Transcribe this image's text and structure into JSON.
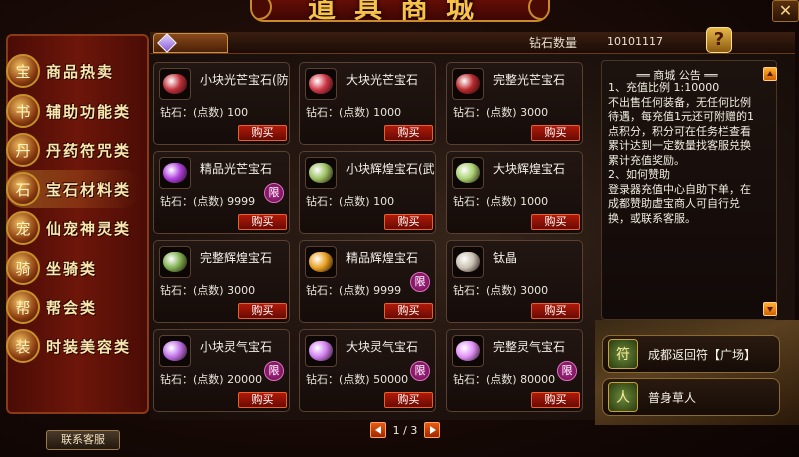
{
  "window": {
    "title": "道具商城",
    "close_symbol": "✕"
  },
  "header": {
    "diamond_label": "钻石数量",
    "diamond_value": "10101117",
    "help_icon": "scroll-help-icon"
  },
  "sidebar": {
    "items": [
      {
        "label": "商品热卖",
        "icon": "treasure-chest-icon",
        "glyph": "宝"
      },
      {
        "label": "辅助功能类",
        "icon": "book-icon",
        "glyph": "书"
      },
      {
        "label": "丹药符咒类",
        "icon": "pill-icon",
        "glyph": "丹"
      },
      {
        "label": "宝石材料类",
        "icon": "gem-icon",
        "glyph": "石",
        "active": true
      },
      {
        "label": "仙宠神灵类",
        "icon": "pet-icon",
        "glyph": "宠"
      },
      {
        "label": "坐骑类",
        "icon": "mount-icon",
        "glyph": "骑"
      },
      {
        "label": "帮会类",
        "icon": "guild-icon",
        "glyph": "帮"
      },
      {
        "label": "时装美容类",
        "icon": "fashion-icon",
        "glyph": "装"
      }
    ],
    "support_button": "联系客服"
  },
  "tabs": [
    {
      "icon": "purple-gem-icon"
    }
  ],
  "products": [
    {
      "name": "小块光芒宝石(防",
      "price": "钻石：(点数) 100",
      "buy": "购买",
      "color": "#c0303a",
      "limited": false
    },
    {
      "name": "大块光芒宝石",
      "price": "钻石：(点数) 1000",
      "buy": "购买",
      "color": "#d03848",
      "limited": false
    },
    {
      "name": "完整光芒宝石",
      "price": "钻石：(点数) 3000",
      "buy": "购买",
      "color": "#b8282c",
      "limited": false
    },
    {
      "name": "精品光芒宝石",
      "price": "钻石：(点数) 9999",
      "buy": "购买",
      "color": "#b040e0",
      "limited": true
    },
    {
      "name": "小块辉煌宝石(武",
      "price": "钻石：(点数) 100",
      "buy": "购买",
      "color": "#9ac060",
      "limited": false
    },
    {
      "name": "大块辉煌宝石",
      "price": "钻石：(点数) 1000",
      "buy": "购买",
      "color": "#a8d070",
      "limited": false
    },
    {
      "name": "完整辉煌宝石",
      "price": "钻石：(点数) 3000",
      "buy": "购买",
      "color": "#80b050",
      "limited": false
    },
    {
      "name": "精品辉煌宝石",
      "price": "钻石：(点数) 9999",
      "buy": "购买",
      "color": "#e8a020",
      "limited": true
    },
    {
      "name": "钛晶",
      "price": "钻石：(点数) 3000",
      "buy": "购买",
      "color": "#c8c0b0",
      "limited": false
    },
    {
      "name": "小块灵气宝石",
      "price": "钻石：(点数) 20000",
      "buy": "购买",
      "color": "#c070e8",
      "limited": true
    },
    {
      "name": "大块灵气宝石",
      "price": "钻石：(点数) 50000",
      "buy": "购买",
      "color": "#d080f0",
      "limited": true
    },
    {
      "name": "完整灵气宝石",
      "price": "钻石：(点数) 80000",
      "buy": "购买",
      "color": "#e090f8",
      "limited": true
    }
  ],
  "limit_badge": "限",
  "notice": {
    "title": "══ 商城 公告 ══",
    "body": "1、充值比例 1:10000\n不出售任何装备，无任何比例待遇，每充值1元还可附赠的1点积分，积分可在任务栏查看累计达到一定数量找客服兑换累计充值奖励。\n2、如何赞助\n登录器充值中心自助下单，在成都赞助虚宝商人可自行兑换，或联系客服。"
  },
  "quick_actions": [
    {
      "label": "成都返回符【广场】",
      "icon": "return-scroll-icon",
      "glyph": "符"
    },
    {
      "label": "普身草人",
      "icon": "straw-doll-icon",
      "glyph": "人"
    }
  ],
  "pagination": {
    "text": "1 / 3"
  }
}
